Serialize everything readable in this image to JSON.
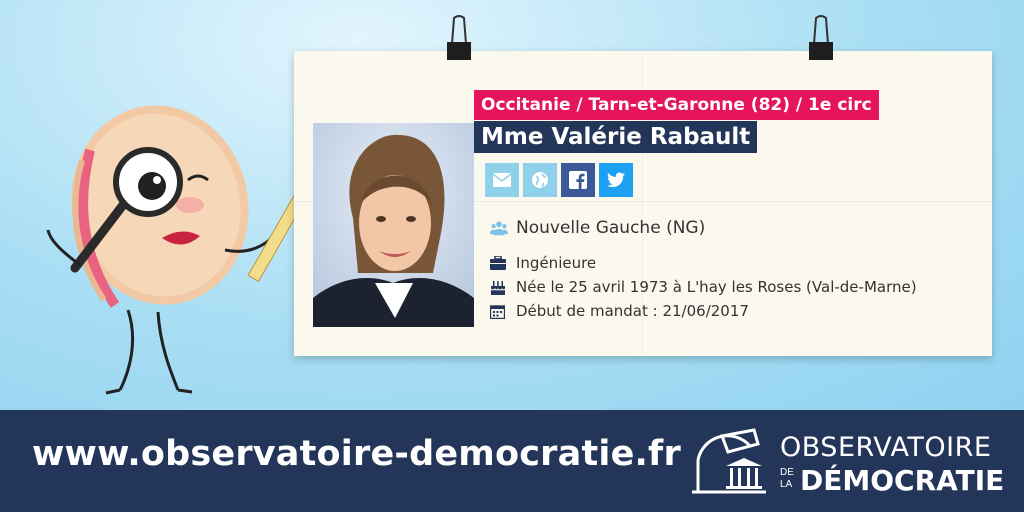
{
  "card": {
    "region": "Occitanie / Tarn-et-Garonne (82) / 1e circ",
    "name": "Mme Valérie Rabault",
    "party": "Nouvelle Gauche (NG)",
    "profession": "Ingénieure",
    "birth": "Née le 25 avril 1973 à L'hay les Roses (Val-de-Marne)",
    "mandate": "Début de mandat : 21/06/2017",
    "social": [
      {
        "icon": "email-icon",
        "color": "#8fd1ea"
      },
      {
        "icon": "globe-icon",
        "color": "#8fd1ea"
      },
      {
        "icon": "facebook-icon",
        "color": "#3b5998"
      },
      {
        "icon": "twitter-icon",
        "color": "#1da1f2"
      }
    ]
  },
  "footer": {
    "url": "www.observatoire-democratie.fr",
    "logo_line1": "OBSERVATOIRE",
    "logo_de": "DE",
    "logo_la": "LA",
    "logo_line2": "DÉMOCRATIE"
  },
  "colors": {
    "accent": "#e6135d",
    "navy": "#24355a",
    "sky": "#a9def4"
  }
}
